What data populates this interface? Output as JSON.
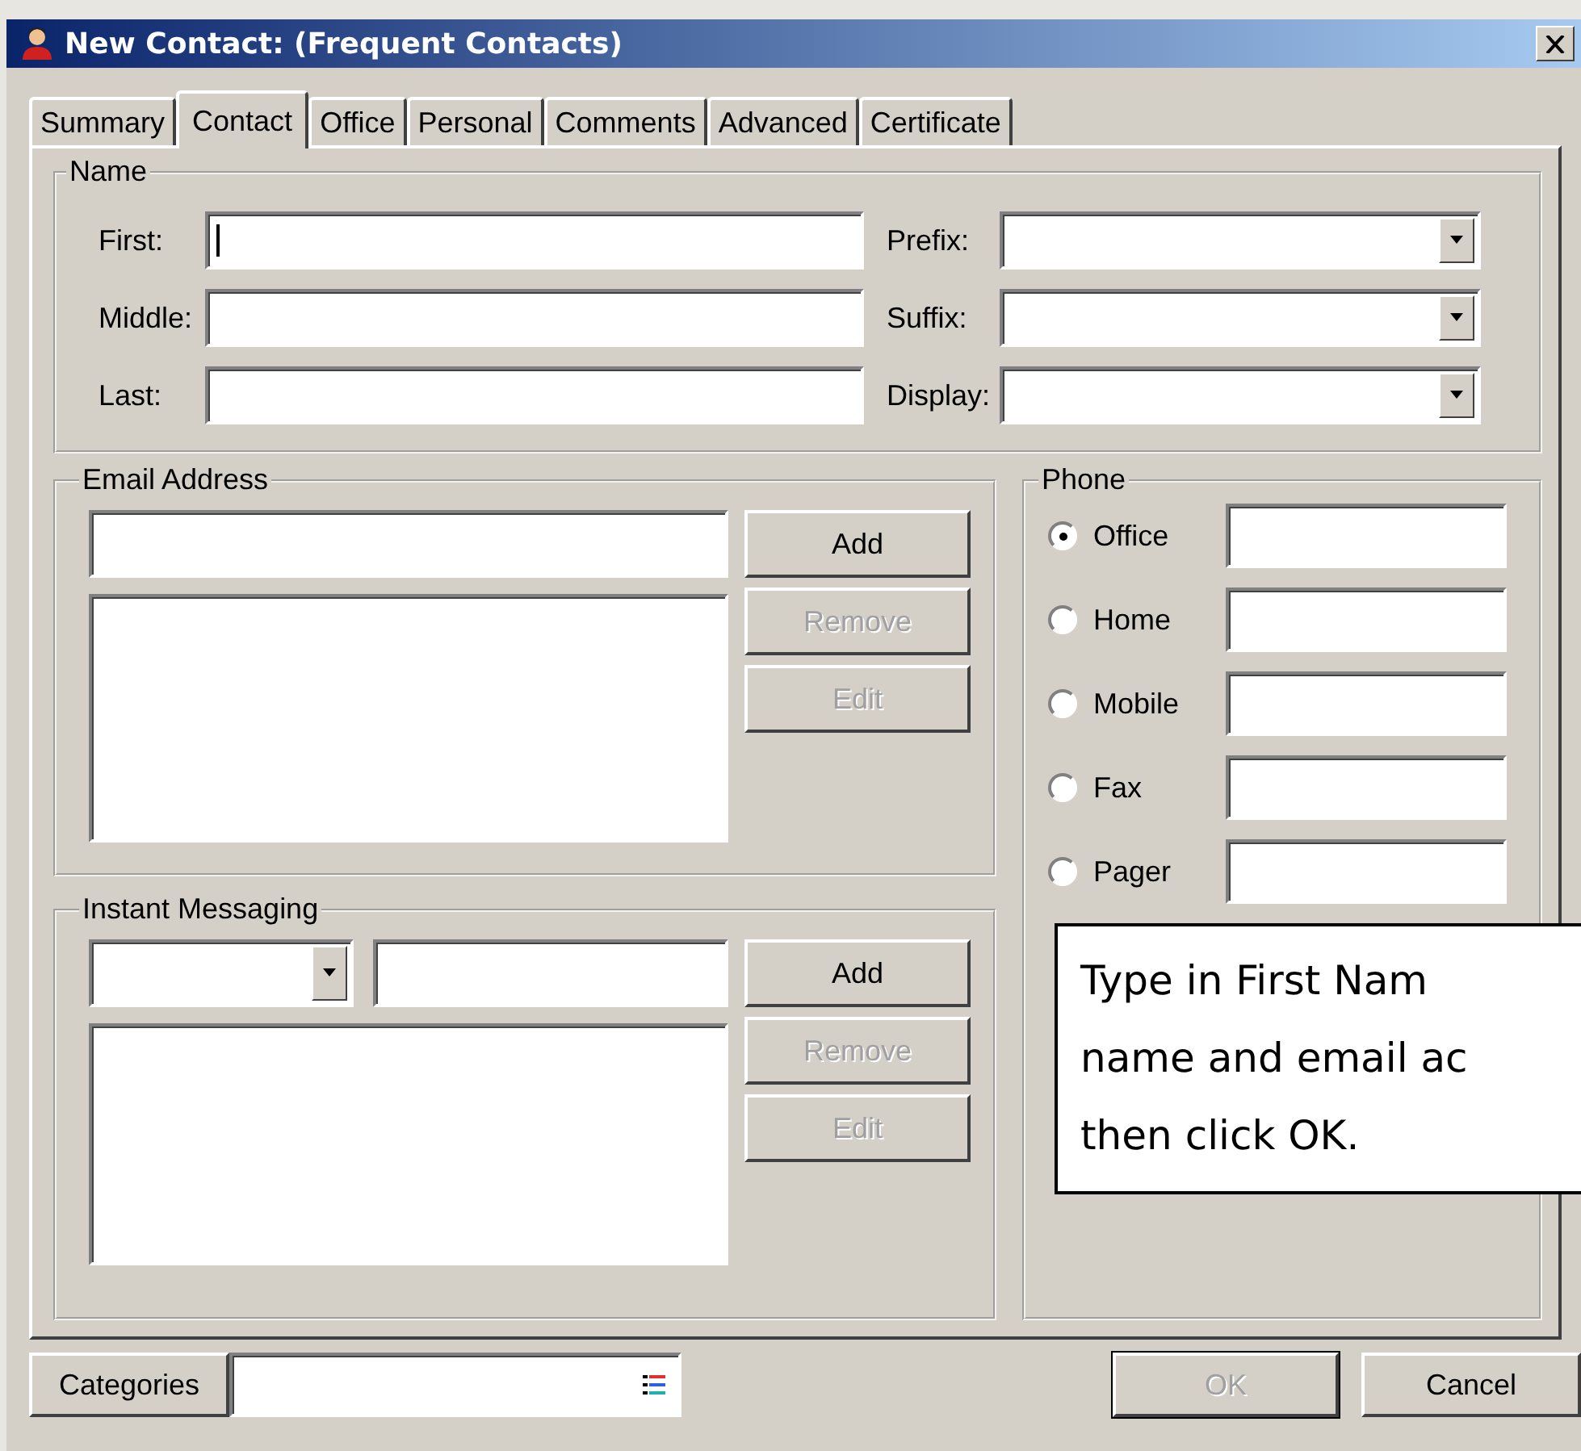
{
  "window": {
    "title": "New Contact:  (Frequent Contacts)"
  },
  "tabs": [
    {
      "label": "Summary",
      "selected": false
    },
    {
      "label": "Contact",
      "selected": true
    },
    {
      "label": "Office",
      "selected": false
    },
    {
      "label": "Personal",
      "selected": false
    },
    {
      "label": "Comments",
      "selected": false
    },
    {
      "label": "Advanced",
      "selected": false
    },
    {
      "label": "Certificate",
      "selected": false
    }
  ],
  "name_group": {
    "legend": "Name",
    "text_fields": [
      {
        "label": "First:",
        "focused": true
      },
      {
        "label": "Middle:",
        "focused": false
      },
      {
        "label": "Last:",
        "focused": false
      }
    ],
    "dropdowns": [
      {
        "label": "Prefix:"
      },
      {
        "label": "Suffix:"
      },
      {
        "label": "Display:"
      }
    ]
  },
  "email": {
    "legend": "Email Address",
    "buttons": [
      {
        "label": "Add",
        "disabled": false
      },
      {
        "label": "Remove",
        "disabled": true
      },
      {
        "label": "Edit",
        "disabled": true
      }
    ]
  },
  "instant_messaging": {
    "legend": "Instant Messaging",
    "buttons": [
      {
        "label": "Add",
        "disabled": false
      },
      {
        "label": "Remove",
        "disabled": true
      },
      {
        "label": "Edit",
        "disabled": true
      }
    ]
  },
  "phone": {
    "legend": "Phone",
    "options": [
      {
        "label": "Office",
        "selected": true
      },
      {
        "label": "Home",
        "selected": false
      },
      {
        "label": "Mobile",
        "selected": false
      },
      {
        "label": "Fax",
        "selected": false
      },
      {
        "label": "Pager",
        "selected": false
      }
    ]
  },
  "callout": {
    "lines": [
      "Type in First Nam",
      "name and email ac",
      "then click OK."
    ]
  },
  "footer": {
    "categories_button": "Categories",
    "ok": {
      "label": "OK",
      "disabled": true
    },
    "cancel": {
      "label": "Cancel",
      "disabled": false
    }
  }
}
